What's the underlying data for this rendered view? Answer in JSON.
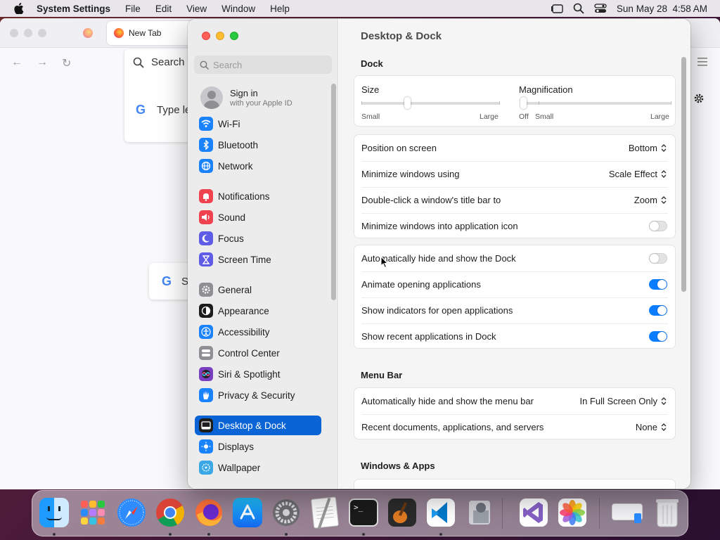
{
  "menubar": {
    "app": "System Settings",
    "items": [
      "File",
      "Edit",
      "View",
      "Window",
      "Help"
    ],
    "datetime": "Sun May 28  4:58 AM"
  },
  "browser": {
    "tab_title": "New Tab",
    "search_placeholder": "Search w",
    "type_hint": "Type le",
    "google_letter": "G",
    "second_card_text": "S"
  },
  "settings": {
    "search_placeholder": "Search",
    "signin": {
      "title": "Sign in",
      "subtitle": "with your Apple ID"
    },
    "sidebar": [
      {
        "label": "Wi-Fi",
        "icon": "wifi-icon",
        "color": "#1a82fb"
      },
      {
        "label": "Bluetooth",
        "icon": "bluetooth-icon",
        "color": "#1a82fb"
      },
      {
        "label": "Network",
        "icon": "globe-icon",
        "color": "#1a82fb"
      },
      {
        "label": "Notifications",
        "icon": "bell-icon",
        "color": "#f0424f"
      },
      {
        "label": "Sound",
        "icon": "speaker-icon",
        "color": "#f0424f"
      },
      {
        "label": "Focus",
        "icon": "moon-icon",
        "color": "#5e5ce6"
      },
      {
        "label": "Screen Time",
        "icon": "hourglass-icon",
        "color": "#5e5ce6"
      },
      {
        "label": "General",
        "icon": "gear-icon",
        "color": "#8e8e93"
      },
      {
        "label": "Appearance",
        "icon": "appearance-icon",
        "color": "#1d1d1f"
      },
      {
        "label": "Accessibility",
        "icon": "accessibility-icon",
        "color": "#1a82fb"
      },
      {
        "label": "Control Center",
        "icon": "control-center-icon",
        "color": "#8e8e93"
      },
      {
        "label": "Siri & Spotlight",
        "icon": "siri-icon",
        "color": "#7a3fbf"
      },
      {
        "label": "Privacy & Security",
        "icon": "hand-icon",
        "color": "#1a82fb"
      },
      {
        "label": "Desktop & Dock",
        "icon": "dock-icon",
        "color": "#1d1d1f"
      },
      {
        "label": "Displays",
        "icon": "sun-icon",
        "color": "#1a82fb"
      },
      {
        "label": "Wallpaper",
        "icon": "wallpaper-icon",
        "color": "#3aa7e6"
      }
    ],
    "page_title": "Desktop & Dock",
    "dock_section": "Dock",
    "size": {
      "label": "Size",
      "min": "Small",
      "max": "Large",
      "value": 0.33
    },
    "magnification": {
      "label": "Magnification",
      "off": "Off",
      "min": "Small",
      "max": "Large",
      "value": 0.0
    },
    "group1": [
      {
        "label": "Position on screen",
        "value": "Bottom"
      },
      {
        "label": "Minimize windows using",
        "value": "Scale Effect"
      },
      {
        "label": "Double-click a window's title bar to",
        "value": "Zoom"
      },
      {
        "label": "Minimize windows into application icon",
        "toggle": false
      }
    ],
    "group2": [
      {
        "label": "Automatically hide and show the Dock",
        "toggle": false
      },
      {
        "label": "Animate opening applications",
        "toggle": true
      },
      {
        "label": "Show indicators for open applications",
        "toggle": true
      },
      {
        "label": "Show recent applications in Dock",
        "toggle": true
      }
    ],
    "menubar_section": "Menu Bar",
    "group3": [
      {
        "label": "Automatically hide and show the menu bar",
        "value": "In Full Screen Only"
      },
      {
        "label": "Recent documents, applications, and servers",
        "value": "None"
      }
    ],
    "windows_section": "Windows & Apps"
  },
  "dock": [
    {
      "name": "finder-icon",
      "running": true
    },
    {
      "name": "launchpad-icon",
      "running": false
    },
    {
      "name": "safari-icon",
      "running": false
    },
    {
      "name": "chrome-icon",
      "running": true
    },
    {
      "name": "firefox-icon",
      "running": true
    },
    {
      "name": "app-store-icon",
      "running": false
    },
    {
      "name": "system-settings-icon",
      "running": true
    },
    {
      "name": "textedit-icon",
      "running": false
    },
    {
      "name": "terminal-icon",
      "running": true
    },
    {
      "name": "garageband-icon",
      "running": false
    },
    {
      "name": "vscode-icon",
      "running": true
    },
    {
      "name": "migration-assistant-icon",
      "running": false
    },
    {
      "name": "visual-studio-icon",
      "running": false
    },
    {
      "name": "photos-icon",
      "running": false
    },
    {
      "name": "downloads-stack-icon",
      "running": false
    },
    {
      "name": "trash-icon",
      "running": false
    }
  ]
}
